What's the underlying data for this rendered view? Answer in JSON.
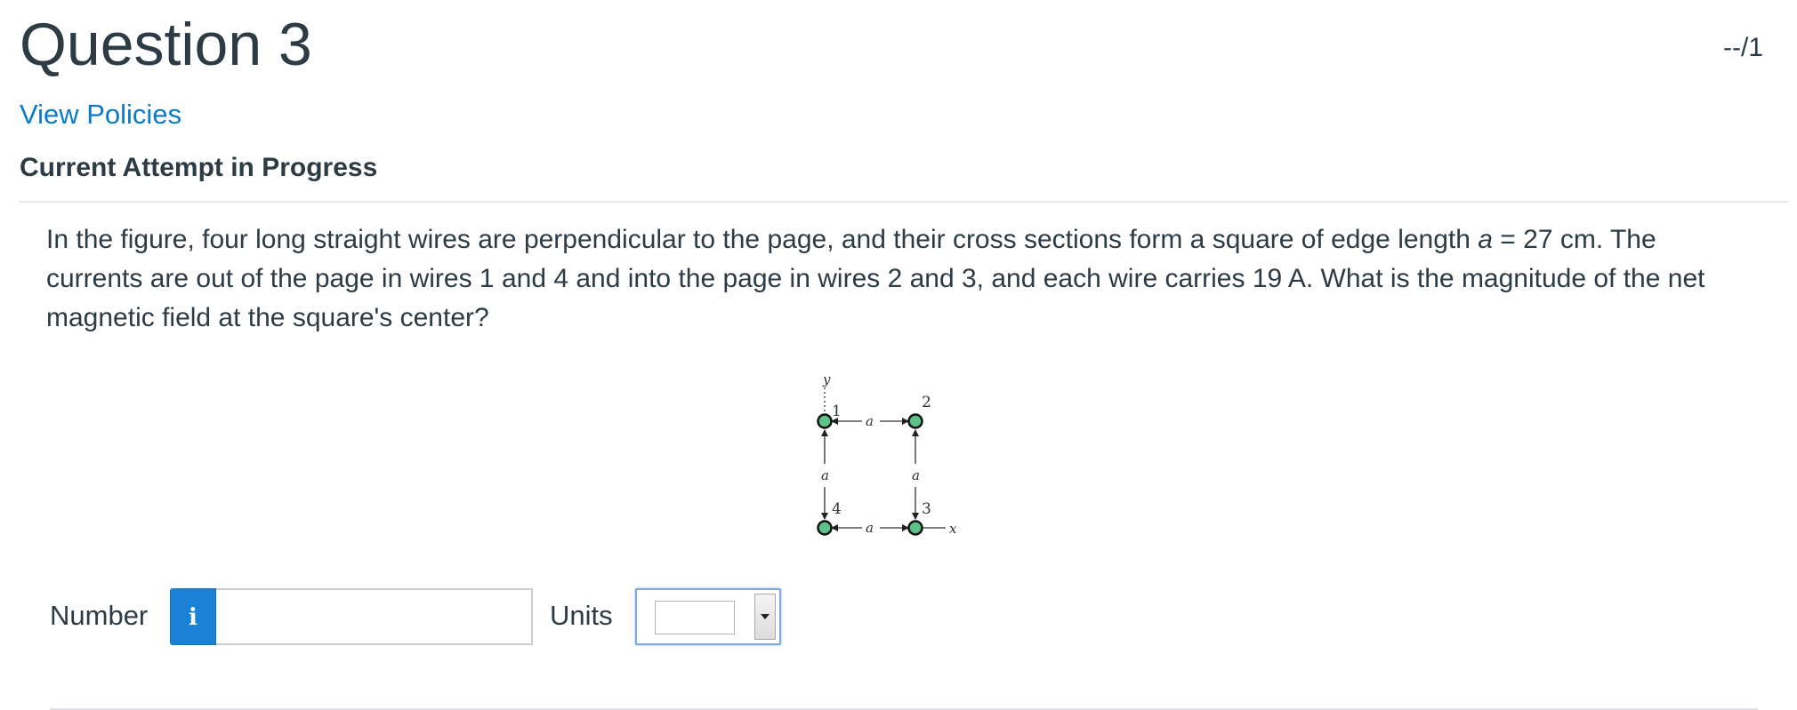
{
  "question": {
    "title": "Question 3",
    "points": "--/1"
  },
  "links": {
    "view_policies": "View Policies"
  },
  "attempt": {
    "status": "Current Attempt in Progress"
  },
  "problem": {
    "text_part1": "In the figure, four long straight wires are perpendicular to the page, and their cross sections form a square of edge length ",
    "var_a": "a",
    "text_part2": " = 27 cm. The currents are out of the page in wires 1 and 4 and into the page in wires 2 and 3, and each wire carries 19 A. What is the magnitude of the net magnetic field at the square's center?"
  },
  "figure": {
    "axis_y": "y",
    "axis_x": "x",
    "edge_label": "a",
    "wire_labels": [
      "1",
      "2",
      "3",
      "4"
    ],
    "wire_color": "#5cc287"
  },
  "answer": {
    "number_label": "Number",
    "info_icon": "i",
    "number_value": "",
    "units_label": "Units",
    "units_value": ""
  }
}
